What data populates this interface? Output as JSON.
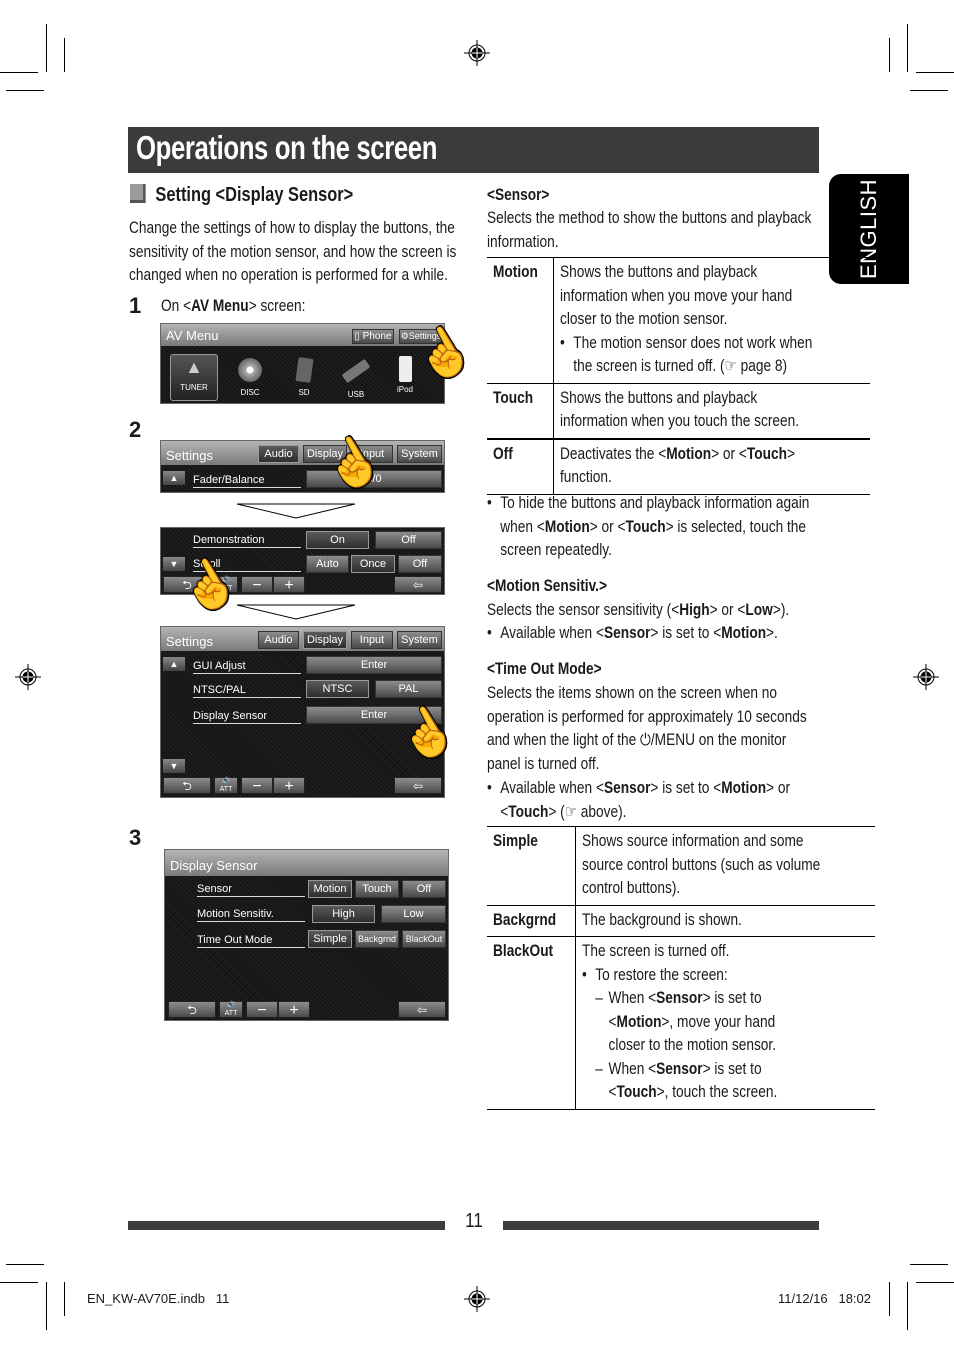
{
  "page": {
    "title": "Operations on the screen",
    "language_tab": "ENGLISH",
    "page_number": "11",
    "footer_left": "EN_KW-AV70E.indb   11",
    "footer_right": "11/12/16   18:02"
  },
  "section": {
    "heading": "Setting <Display Sensor>",
    "intro_lines": [
      "Change the settings of how to display the buttons, the",
      "sensitivity of the motion sensor, and how the screen is",
      "changed when no operation is performed for a while."
    ]
  },
  "steps": [
    {
      "number": "1",
      "instruction_prefix": "On <",
      "instruction_bold": "AV Menu",
      "instruction_suffix": "> screen:",
      "screen": {
        "title": "AV Menu",
        "header_buttons": [
          "Phone",
          "Settings"
        ],
        "sources": [
          "TUNER",
          "DISC",
          "SD",
          "USB",
          "iPod"
        ],
        "selected_source": "TUNER"
      }
    },
    {
      "number": "2",
      "screen_a": {
        "title": "Settings",
        "tabs": [
          "Audio",
          "Display",
          "Input",
          "System"
        ],
        "selected_tab": "Audio",
        "rows": [
          {
            "label": "Fader/Balance",
            "value": "0/0"
          }
        ]
      },
      "screen_b": {
        "rows": [
          {
            "label": "Demonstration",
            "options": [
              "On",
              "Off"
            ],
            "selected": "On"
          },
          {
            "label": "Scroll",
            "options": [
              "Auto",
              "Once",
              "Off"
            ],
            "selected": "Once"
          }
        ],
        "bottom": {
          "att": "ATT",
          "minus": "−",
          "plus": "+"
        }
      },
      "screen_c": {
        "title": "Settings",
        "tabs": [
          "Audio",
          "Display",
          "Input",
          "System"
        ],
        "selected_tab": "Display",
        "rows": [
          {
            "label": "GUI Adjust",
            "options": [
              "Enter"
            ]
          },
          {
            "label": "NTSC/PAL",
            "options": [
              "NTSC",
              "PAL"
            ],
            "selected": "NTSC"
          },
          {
            "label": "Display Sensor",
            "options": [
              "Enter"
            ]
          }
        ],
        "bottom": {
          "att": "ATT",
          "minus": "−",
          "plus": "+"
        }
      }
    },
    {
      "number": "3",
      "screen": {
        "title": "Display Sensor",
        "rows": [
          {
            "label": "Sensor",
            "options": [
              "Motion",
              "Touch",
              "Off"
            ],
            "selected": "Motion"
          },
          {
            "label": "Motion Sensitiv.",
            "options": [
              "High",
              "Low"
            ],
            "selected": "High"
          },
          {
            "label": "Time Out Mode",
            "options": [
              "Simple",
              "Backgrnd",
              "BlackOut"
            ],
            "selected": "Simple"
          }
        ],
        "bottom": {
          "att": "ATT",
          "minus": "−",
          "plus": "+"
        }
      }
    }
  ],
  "sensor": {
    "heading": "<Sensor>",
    "desc_lines": [
      "Selects the method to show the buttons and playback",
      "information."
    ],
    "table": [
      {
        "key": "Motion",
        "lines": [
          "Shows the buttons and playback",
          "information when you move your hand",
          "closer to the motion sensor."
        ],
        "bullet": [
          "The motion sensor does not work when",
          "the screen is turned off. (☞ page 8)"
        ]
      },
      {
        "key": "Touch",
        "lines": [
          "Shows the buttons and playback",
          "information when you touch the screen."
        ]
      },
      {
        "key": "Off",
        "lines_rich": [
          [
            "Deactivates the <",
            "Motion",
            "> or <",
            "Touch",
            ">"
          ],
          [
            "function."
          ]
        ]
      }
    ],
    "note_lines": [
      [
        "To hide the buttons and playback information again"
      ],
      [
        "when <",
        "Motion",
        "> or <",
        "Touch",
        "> is selected, touch the"
      ],
      [
        "screen repeatedly."
      ]
    ]
  },
  "motion_sensitiv": {
    "heading": "<Motion Sensitiv.>",
    "desc": [
      "Selects the sensor sensitivity (<",
      "High",
      "> or <",
      "Low",
      ">)."
    ],
    "note": [
      "Available when <",
      "Sensor",
      "> is set to <",
      "Motion",
      ">."
    ]
  },
  "time_out_mode": {
    "heading": "<Time Out Mode>",
    "desc_lines": [
      "Selects the items shown on the screen when no",
      "operation is performed for approximately 10 seconds",
      "and when the light of the ⏻/MENU on the monitor",
      "panel is turned off."
    ],
    "note_lines": [
      [
        "Available when <",
        "Sensor",
        "> is set to <",
        "Motion",
        "> or"
      ],
      [
        "<",
        "Touch",
        "> (☞ above)."
      ]
    ],
    "table": [
      {
        "key": "Simple",
        "lines": [
          "Shows source information and some",
          "source control buttons (such as volume",
          "control buttons)."
        ]
      },
      {
        "key": "Backgrnd",
        "lines": [
          "The background is shown."
        ]
      },
      {
        "key": "BlackOut",
        "lines": [
          "The screen is turned off."
        ],
        "bullet": "To restore the screen:",
        "dashes": [
          [
            [
              "When <",
              "Sensor",
              "> is set to"
            ],
            [
              "<",
              "Motion",
              ">, move your hand"
            ],
            [
              "closer to the motion sensor."
            ]
          ],
          [
            [
              "When <",
              "Sensor",
              "> is set to"
            ],
            [
              "<",
              "Touch",
              ">, touch the screen."
            ]
          ]
        ]
      }
    ]
  }
}
